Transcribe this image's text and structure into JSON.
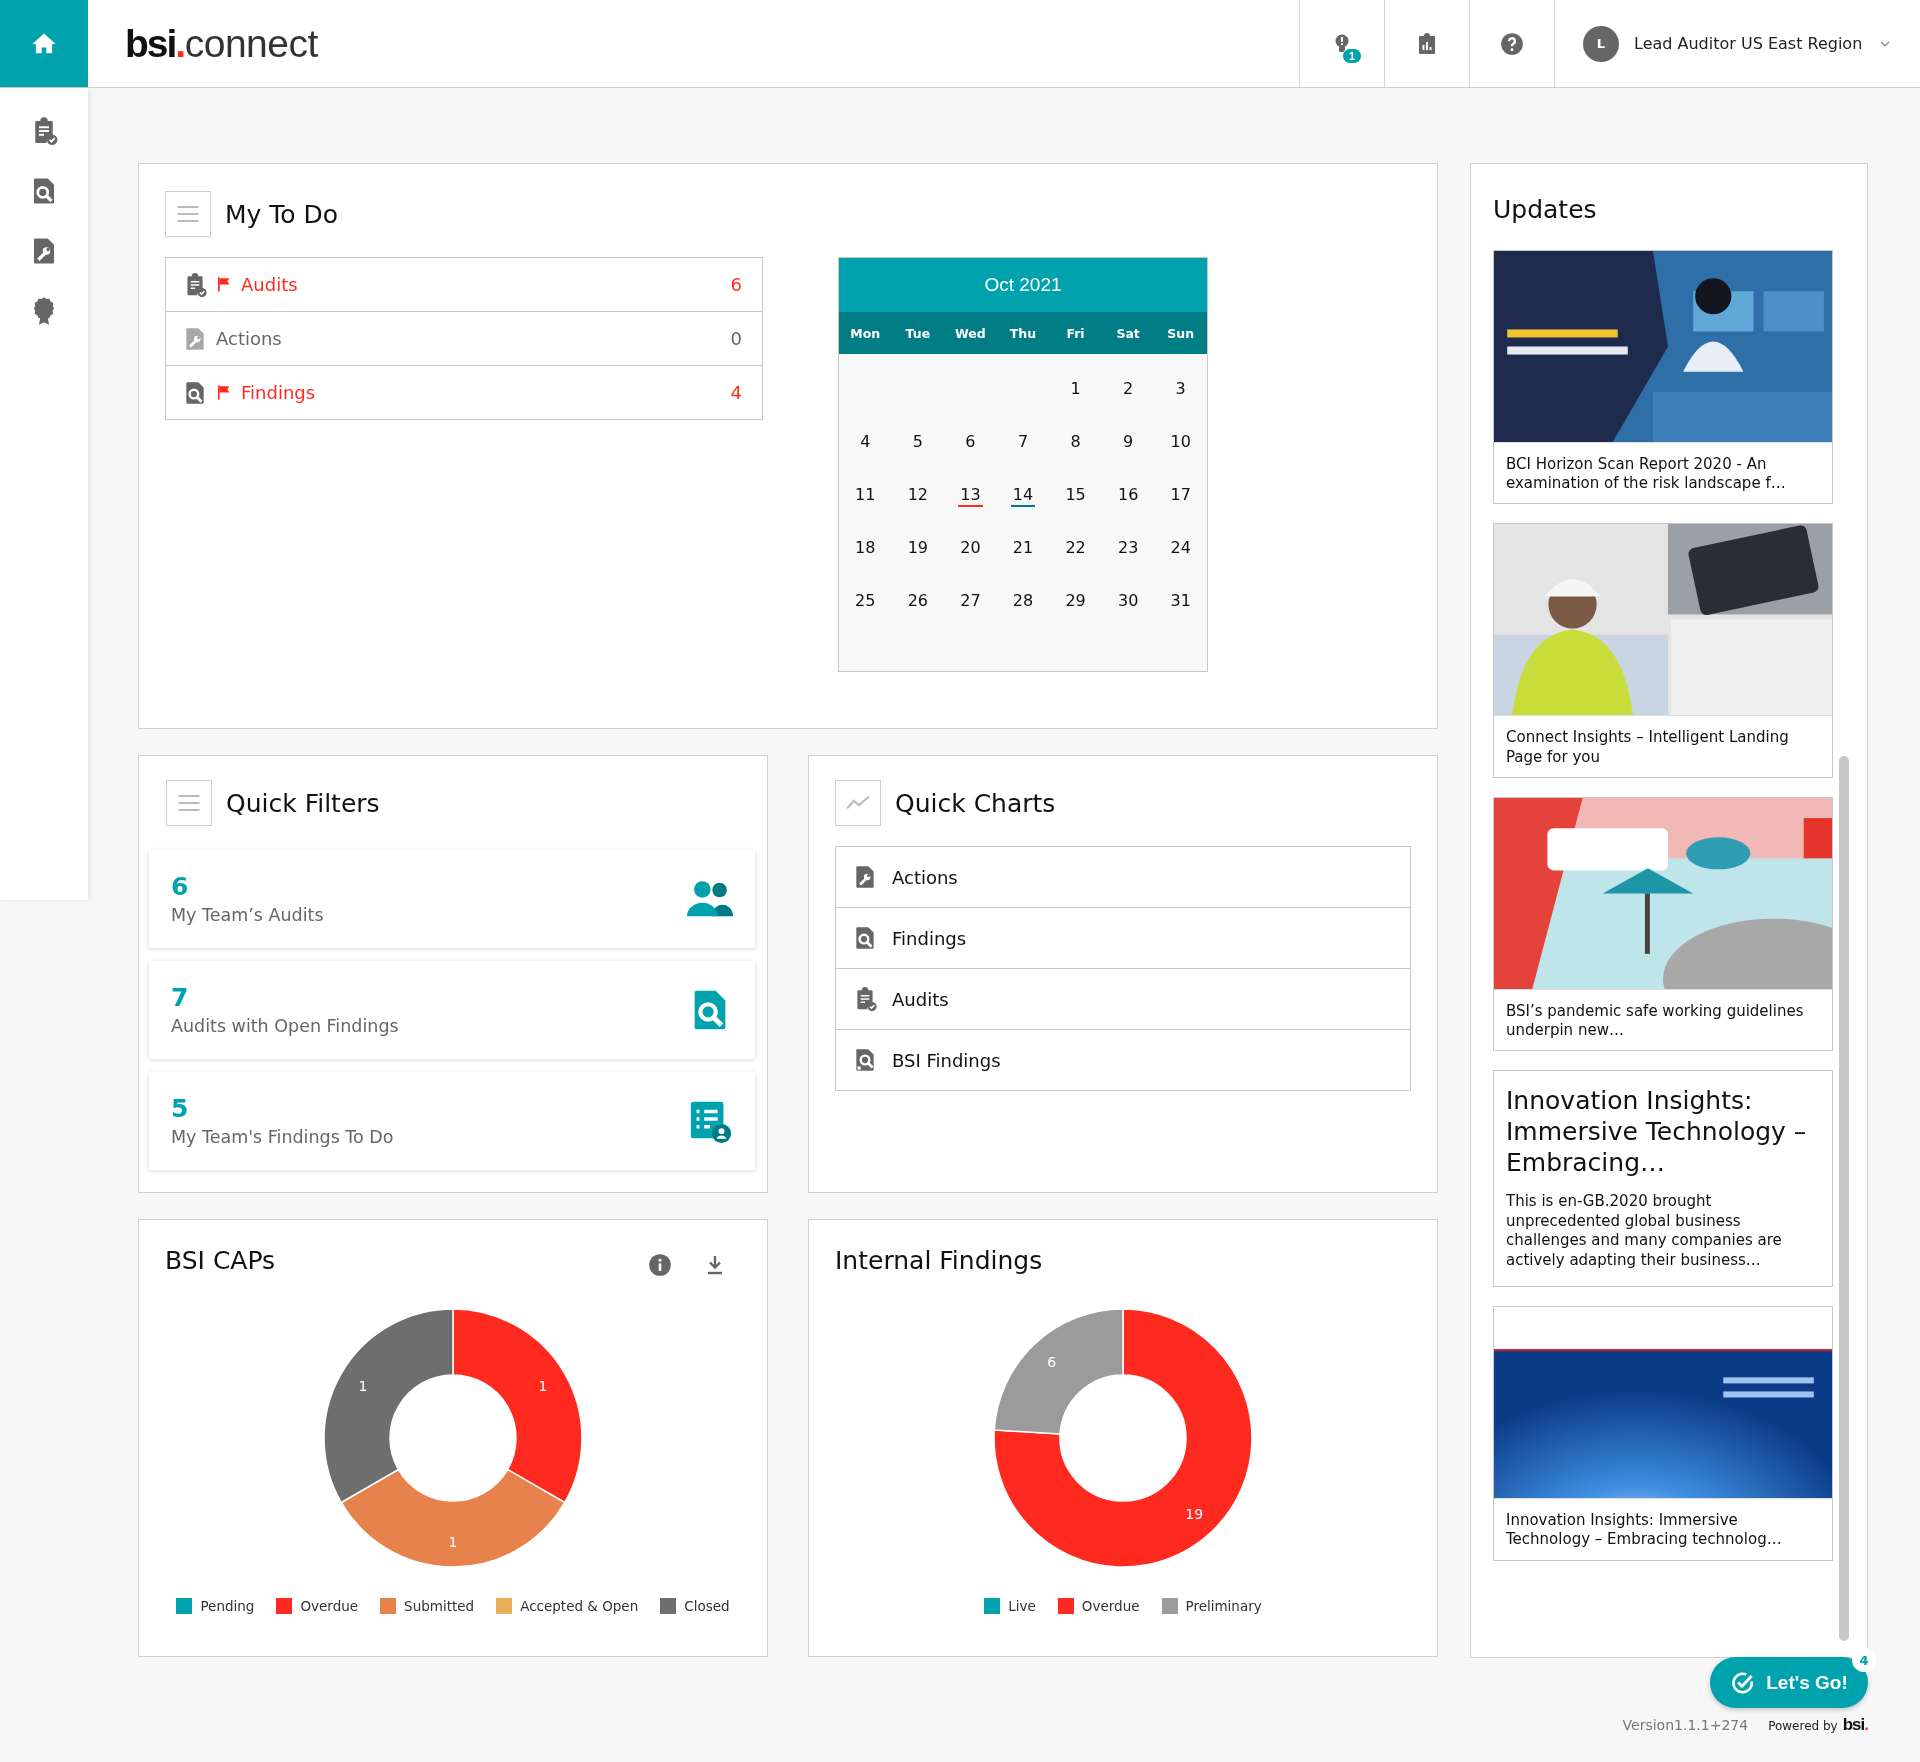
{
  "topbar": {
    "logo": {
      "name": "bsi",
      "dot": ".",
      "product": "connect"
    },
    "notifications_badge": "1",
    "user": {
      "initial": "L",
      "name": "Lead Auditor US East Region"
    }
  },
  "sidebar": {
    "items": [
      {
        "kind": "home",
        "selected": true
      },
      {
        "kind": "audits",
        "selected": false
      },
      {
        "kind": "findings",
        "selected": false
      },
      {
        "kind": "actions",
        "selected": false
      },
      {
        "kind": "certificates",
        "selected": false
      }
    ]
  },
  "my_todo": {
    "title": "My To Do",
    "items": [
      {
        "kind": "audits",
        "label": "Audits",
        "count": "6",
        "flagged": true
      },
      {
        "kind": "actions",
        "label": "Actions",
        "count": "0",
        "flagged": false
      },
      {
        "kind": "findings",
        "label": "Findings",
        "count": "4",
        "flagged": true
      }
    ]
  },
  "calendar": {
    "month": "Oct 2021",
    "weekdays": [
      "Mon",
      "Tue",
      "Wed",
      "Thu",
      "Fri",
      "Sat",
      "Sun"
    ],
    "weeks": [
      [
        {
          "day": "1"
        },
        {
          "day": "2"
        },
        {
          "day": "3"
        }
      ],
      [
        {
          "day": "4"
        },
        {
          "day": "5"
        },
        {
          "day": "6"
        },
        {
          "day": "7"
        },
        {
          "day": "8"
        },
        {
          "day": "9"
        },
        {
          "day": "10"
        }
      ],
      [
        {
          "day": "11"
        },
        {
          "day": "12"
        },
        {
          "day": "13",
          "color": "#ff2a1f"
        },
        {
          "day": "14",
          "color": "#007b85"
        },
        {
          "day": "15"
        },
        {
          "day": "16"
        },
        {
          "day": "17"
        }
      ],
      [
        {
          "day": "18"
        },
        {
          "day": "19"
        },
        {
          "day": "20"
        },
        {
          "day": "21"
        },
        {
          "day": "22"
        },
        {
          "day": "23"
        },
        {
          "day": "24"
        }
      ],
      [
        {
          "day": "25"
        },
        {
          "day": "26"
        },
        {
          "day": "27"
        },
        {
          "day": "28"
        },
        {
          "day": "29"
        },
        {
          "day": "30"
        },
        {
          "day": "31"
        }
      ]
    ]
  },
  "quick_filters": {
    "title": "Quick Filters",
    "items": [
      {
        "kind": "team",
        "count": "6",
        "label": "My Team’s Audits"
      },
      {
        "kind": "findings",
        "count": "7",
        "label": "Audits with Open Findings"
      },
      {
        "kind": "todo",
        "count": "5",
        "label": "My Team's Findings To Do"
      }
    ]
  },
  "quick_charts": {
    "title": "Quick Charts",
    "items": [
      {
        "kind": "actions",
        "label": "Actions"
      },
      {
        "kind": "findings",
        "label": "Findings"
      },
      {
        "kind": "audits",
        "label": "Audits"
      },
      {
        "kind": "bsi_findings",
        "label": "BSI Findings"
      }
    ]
  },
  "bsi_caps": {
    "title": "BSI CAPs",
    "slices": [
      {
        "color": "#00a3ad"
      },
      {
        "color": "#ff2a1f"
      },
      {
        "color": "#e8824c"
      },
      {
        "color": "#e9ae5c"
      },
      {
        "color": "#6e6e6e"
      }
    ],
    "chart_data": {
      "type": "donut",
      "data_labels": true,
      "legend": "bottom",
      "categories": [
        "Pending",
        "Overdue",
        "Submitted",
        "Accepted & Open",
        "Closed"
      ],
      "series": [
        {
          "values": [
            0,
            1,
            1,
            0,
            1
          ]
        }
      ]
    }
  },
  "internal_findings": {
    "title": "Internal Findings",
    "slices": [
      {
        "color": "#00a3ad"
      },
      {
        "color": "#ff2a1f"
      },
      {
        "color": "#9b9b9b"
      }
    ],
    "chart_data": {
      "type": "donut",
      "data_labels": true,
      "legend": "bottom",
      "categories": [
        "Live",
        "Overdue",
        "Preliminary"
      ],
      "series": [
        {
          "values": [
            0,
            19,
            6
          ]
        }
      ]
    }
  },
  "updates": {
    "title": "Updates",
    "items": [
      {
        "kind": "picture",
        "caption": "BCI Horizon Scan Report 2020 - An examination of the risk landscape f…"
      },
      {
        "kind": "picture",
        "caption": "Connect Insights – Intelligent Landing Page for you"
      },
      {
        "kind": "picture",
        "caption": "BSI’s pandemic safe working guidelines underpin new…"
      },
      {
        "kind": "text",
        "title": "Innovation Insights: Immersive Technology – Embracing…",
        "body": "This is en-GB.2020 brought unprecedented global business challenges and many companies are actively adapting their business…"
      },
      {
        "kind": "picture",
        "caption": "Innovation Insights: Immersive Technology – Embracing technolog…"
      }
    ]
  },
  "footer": {
    "lets_go": {
      "label": "Let's Go!",
      "badge": "4"
    },
    "version": "Version1.1.1+274",
    "powered_by": {
      "label": "Powered by",
      "logo": "bsi",
      "dot": "."
    }
  }
}
